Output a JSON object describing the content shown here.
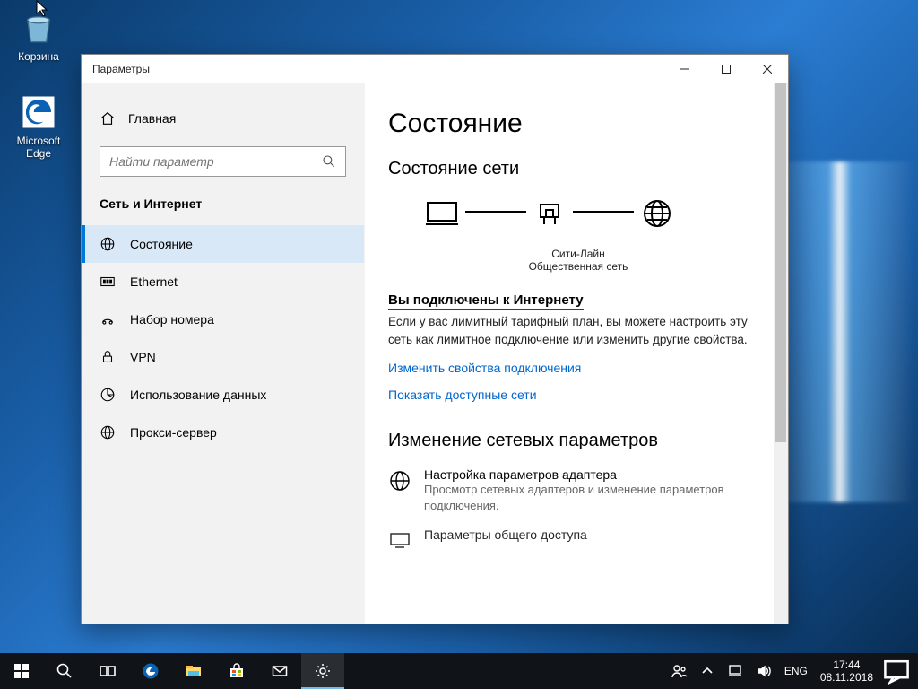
{
  "desktop": {
    "recycle_label": "Корзина",
    "edge_label": "Microsoft Edge"
  },
  "window": {
    "title": "Параметры"
  },
  "sidebar": {
    "home_label": "Главная",
    "search_placeholder": "Найти параметр",
    "category_label": "Сеть и Интернет",
    "items": [
      {
        "label": "Состояние"
      },
      {
        "label": "Ethernet"
      },
      {
        "label": "Набор номера"
      },
      {
        "label": "VPN"
      },
      {
        "label": "Использование данных"
      },
      {
        "label": "Прокси-сервер"
      }
    ]
  },
  "content": {
    "page_title": "Состояние",
    "section_network_state": "Состояние сети",
    "diagram": {
      "network_name": "Сити-Лайн",
      "network_type": "Общественная сеть"
    },
    "connected_heading": "Вы подключены к Интернету",
    "connected_body": "Если у вас лимитный тарифный план, вы можете настроить эту сеть как лимитное подключение или изменить другие свойства.",
    "link_change_props": "Изменить свойства подключения",
    "link_show_networks": "Показать доступные сети",
    "section_change_params": "Изменение сетевых параметров",
    "option_adapter_title": "Настройка параметров адаптера",
    "option_adapter_sub": "Просмотр сетевых адаптеров и изменение параметров подключения.",
    "option_sharing_title": "Параметры общего доступа"
  },
  "taskbar": {
    "lang": "ENG",
    "time": "17:44",
    "date": "08.11.2018"
  }
}
